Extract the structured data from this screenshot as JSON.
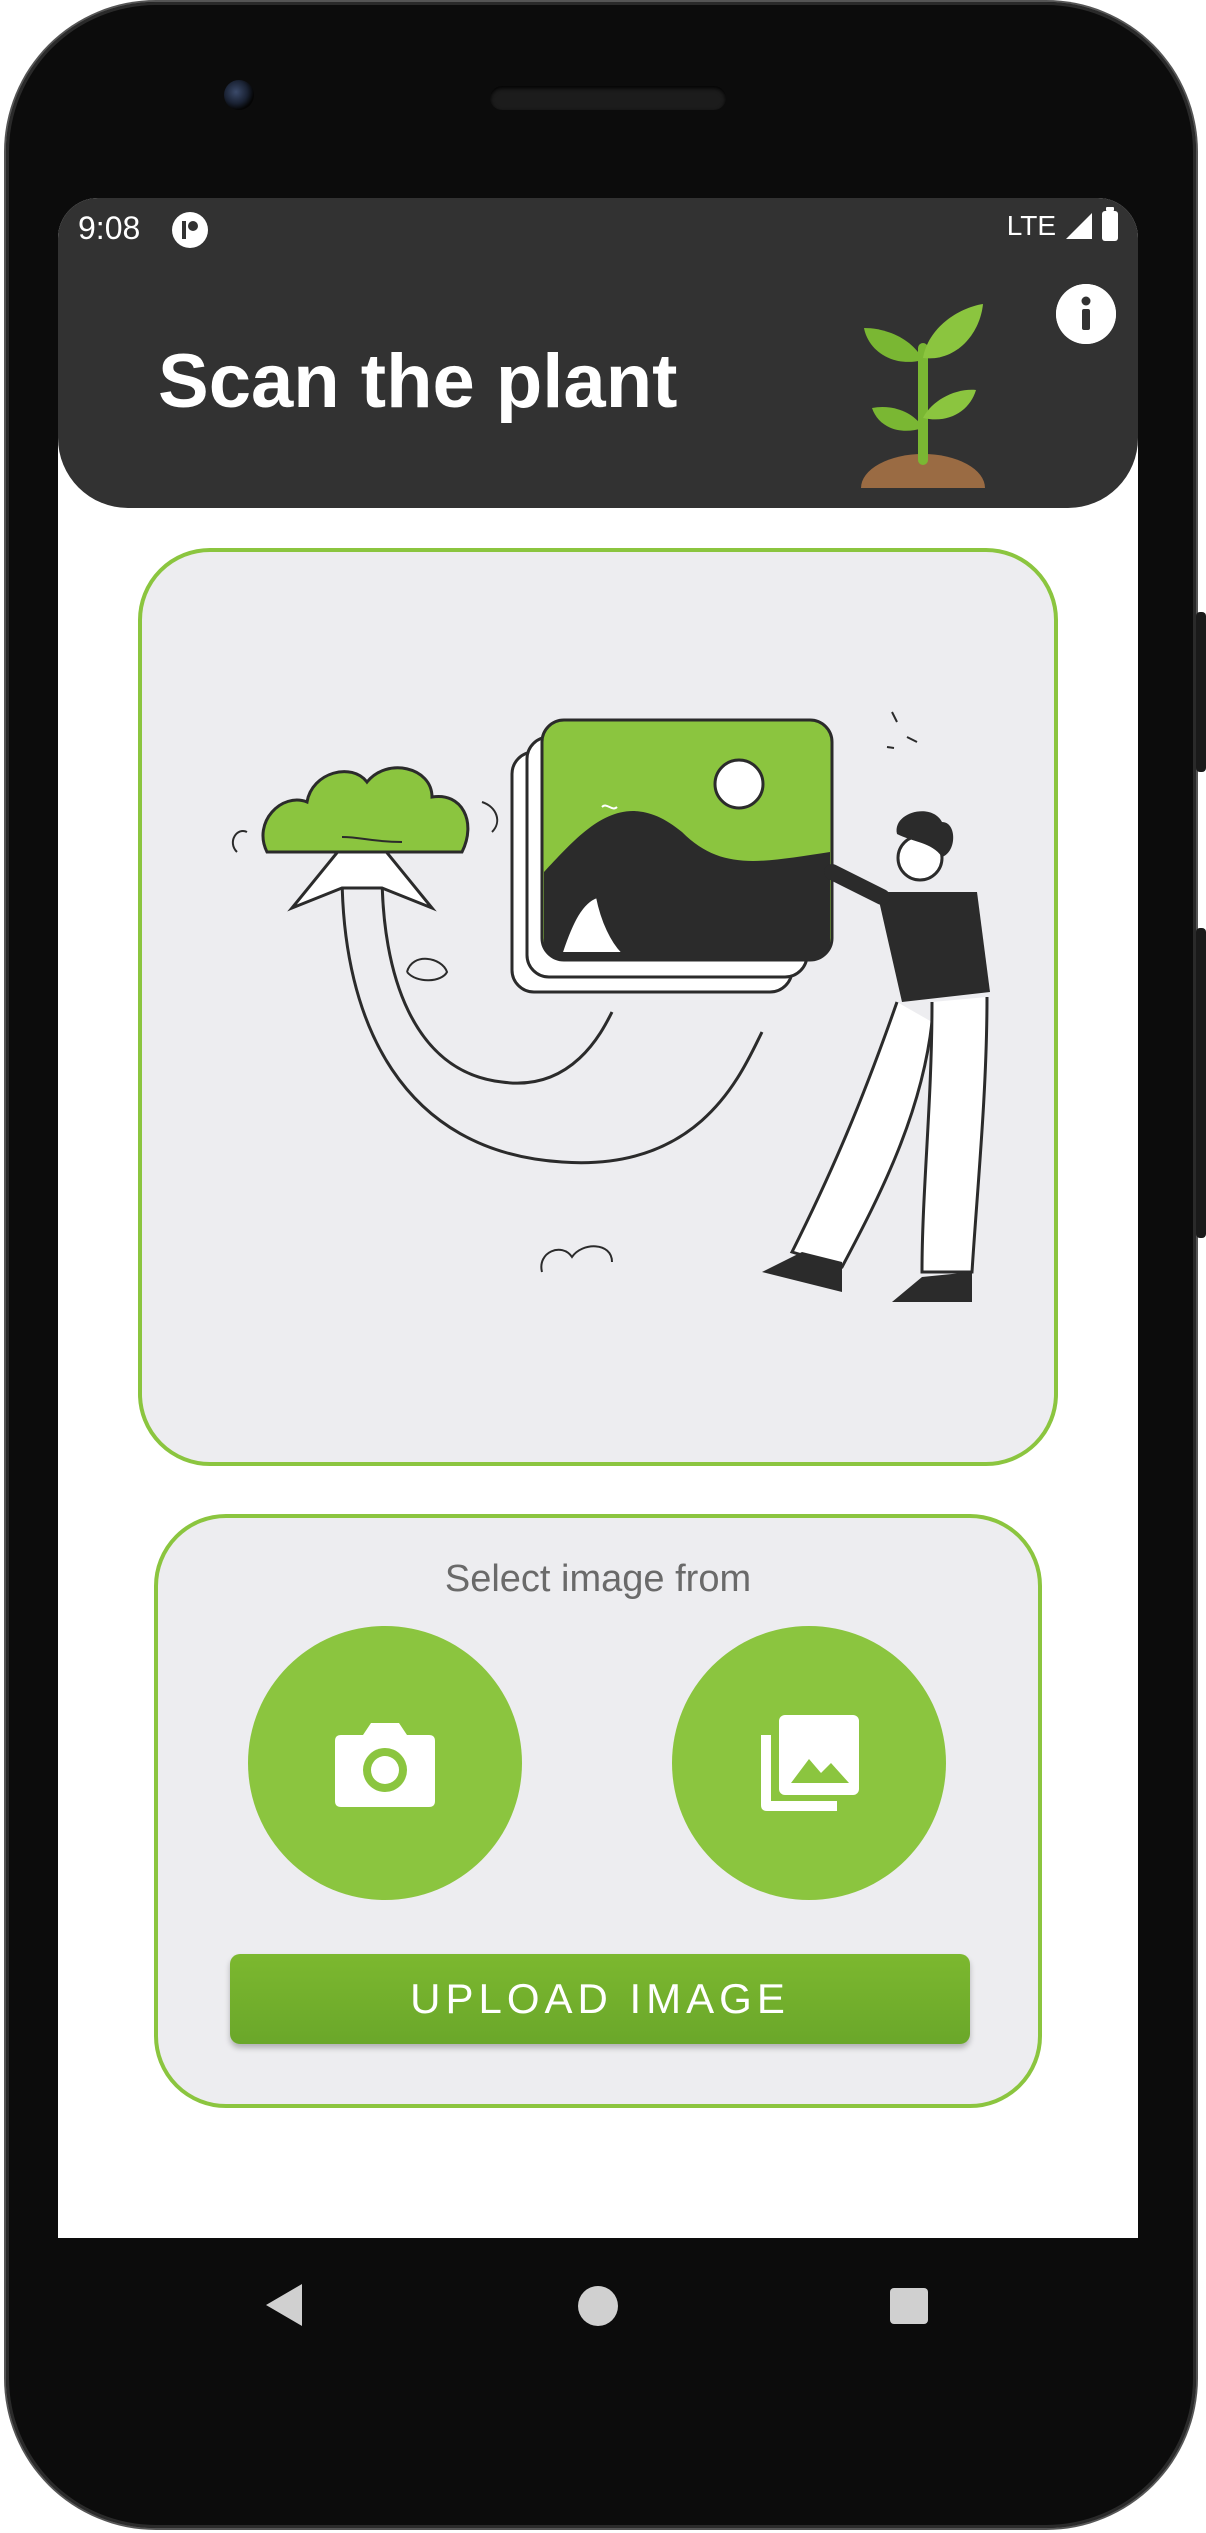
{
  "status_bar": {
    "time": "9:08",
    "network": "LTE"
  },
  "header": {
    "title": "Scan the plant",
    "info_icon": "info-icon",
    "logo_icon": "sprout-icon"
  },
  "select_panel": {
    "label": "Select image from",
    "camera_icon": "camera-icon",
    "gallery_icon": "gallery-icon",
    "upload_label": "UPLOAD IMAGE"
  },
  "navigation": {
    "back_icon": "back-icon",
    "home_icon": "home-icon",
    "recents_icon": "recents-icon"
  },
  "colors": {
    "accent": "#8bc53f",
    "header_bg": "#323232",
    "card_bg": "#ededf0"
  }
}
